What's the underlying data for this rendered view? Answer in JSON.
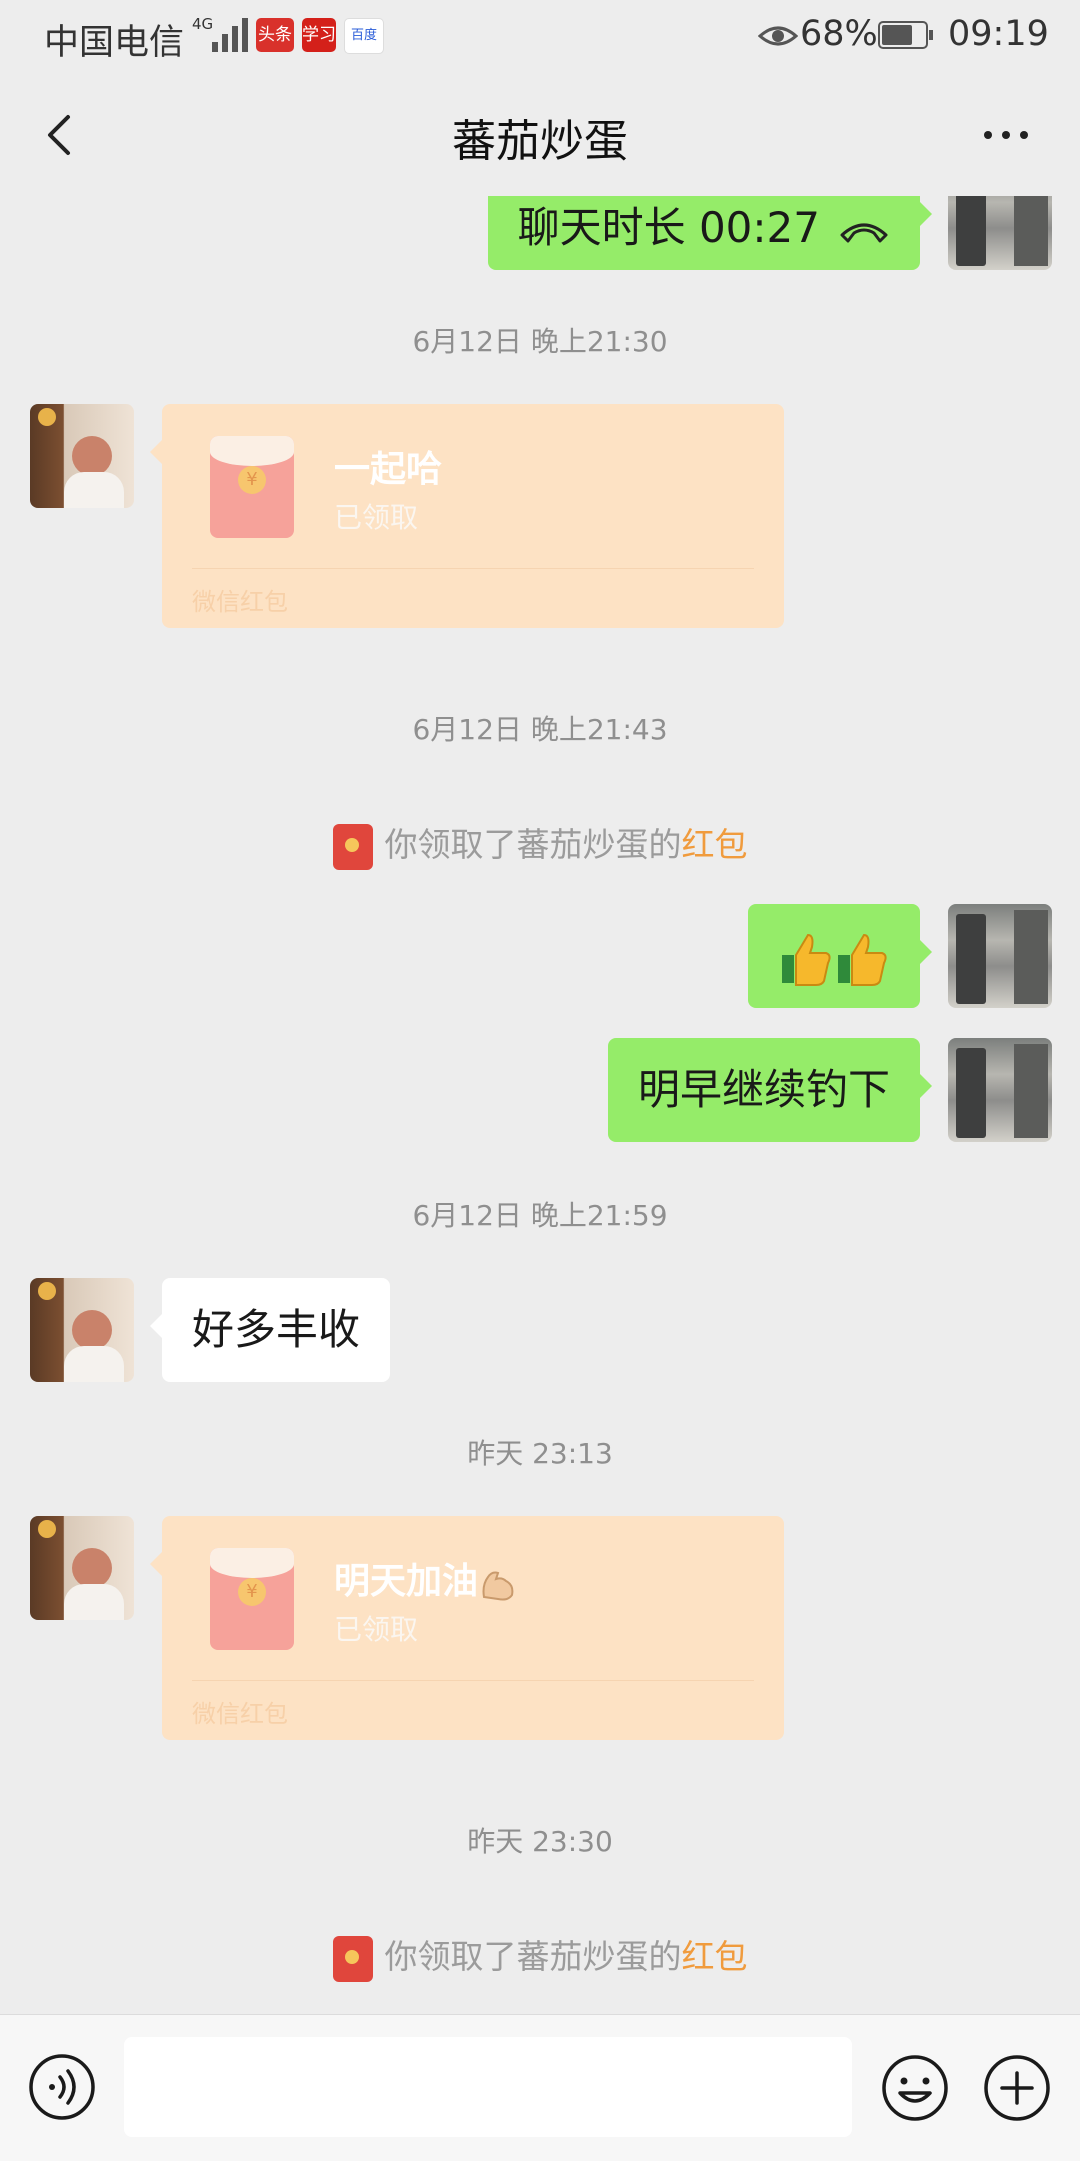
{
  "status_bar": {
    "carrier": "中国电信",
    "network": "4G",
    "apps": [
      "头条",
      "学习",
      "百度"
    ],
    "battery": "68%",
    "time": "09:19"
  },
  "header": {
    "title": "蕃茄炒蛋",
    "back_icon": "chevron-left-icon",
    "more_icon": "more-dots-icon"
  },
  "messages": {
    "call": {
      "text": "聊天时长 00:27",
      "icon": "phone-hangup-icon"
    },
    "time1": "6月12日 晚上21:30",
    "packet1": {
      "title": "一起哈",
      "status": "已领取",
      "footer": "微信红包"
    },
    "time2": "6月12日 晚上21:43",
    "sys1": {
      "prefix": "你领取了蕃茄炒蛋的",
      "link": "红包"
    },
    "thumbs": {
      "icon": "thumbs-up-icon",
      "count": 2
    },
    "msg_text1": "明早继续钓下",
    "time3": "6月12日 晚上21:59",
    "msg_text2": "好多丰收",
    "time4": "昨天 23:13",
    "packet2": {
      "title": "明天加油",
      "status": "已领取",
      "footer": "微信红包",
      "emoji": "flexed-biceps-icon"
    },
    "time5": "昨天 23:30",
    "sys2": {
      "prefix": "你领取了蕃茄炒蛋的",
      "link": "红包"
    }
  },
  "input_bar": {
    "voice_icon": "voice-icon",
    "emoji_icon": "emoji-icon",
    "plus_icon": "plus-icon",
    "text_value": ""
  },
  "colors": {
    "self_bubble": "#95ec69",
    "red_packet": "#fde2c4",
    "link": "#f09b3d"
  }
}
